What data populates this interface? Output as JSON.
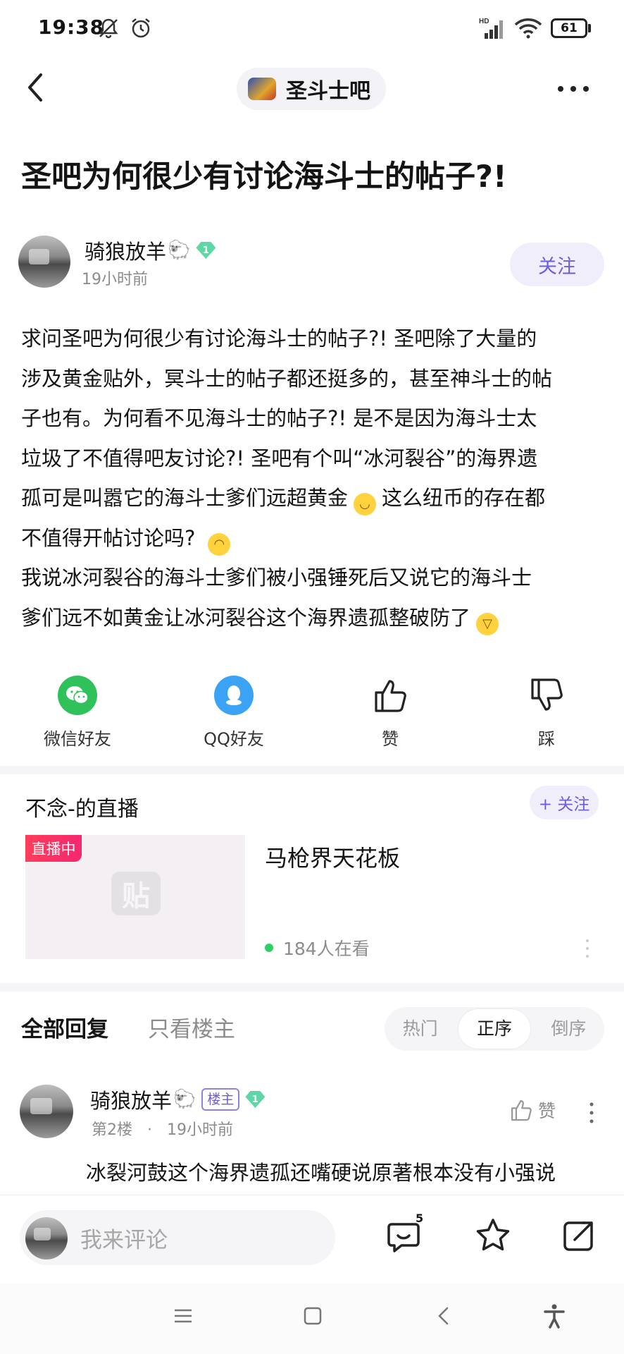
{
  "status_bar": {
    "time": "19:38",
    "battery": "61",
    "icons": [
      "mute-bell-icon",
      "alarm-icon",
      "hd-signal-icon",
      "wifi-icon",
      "battery-icon"
    ]
  },
  "nav": {
    "forum_name": "圣斗士吧"
  },
  "post": {
    "title": "圣吧为何很少有讨论海斗士的帖子?!",
    "author": {
      "name": "骑狼放羊",
      "level": "1",
      "time": "19小时前"
    },
    "follow_label": "关注",
    "body": [
      "求问圣吧为何很少有讨论海斗士的帖子?! 圣吧除了大量的",
      "涉及黄金贴外，冥斗士的帖子都还挺多的，甚至神斗士的帖",
      "子也有。为何看不见海斗士的帖子?! 是不是因为海斗士太",
      "垃圾了不值得吧友讨论?! 圣吧有个叫“冰河裂谷”的海界遗",
      "孤可是叫嚣它的海斗士爹们远超黄金",
      "这么纽币的存在都",
      "不值得开帖讨论吗?",
      "我说冰河裂谷的海斗士爹们被小强锤死后又说它的海斗士",
      "爹们远不如黄金让冰河裂谷这个海界遗孤整破防了"
    ]
  },
  "share": {
    "wechat": "微信好友",
    "qq": "QQ好友",
    "like": "赞",
    "dislike": "踩"
  },
  "live": {
    "title": "不念-的直播",
    "follow_label": "+ 关注",
    "badge": "直播中",
    "placeholder_char": "贴",
    "stream_name": "马枪界天花板",
    "viewers": "184人在看"
  },
  "replies_header": {
    "tab_all": "全部回复",
    "tab_op": "只看楼主",
    "sort_options": [
      "热门",
      "正序",
      "倒序"
    ],
    "active_sort": "正序"
  },
  "reply": {
    "author": "骑狼放羊",
    "op_tag": "楼主",
    "level": "1",
    "floor": "第2楼",
    "separator": "·",
    "time": "19小时前",
    "like_label": "赞",
    "text": "冰裂河鼓这个海界遗孤还嘴硬说原著根本没有小强说"
  },
  "bottom_bar": {
    "comment_placeholder": "我来评论",
    "comment_count": "5"
  },
  "colors": {
    "accent": "#6e5ed8",
    "accent_bg": "#f0eefb",
    "live_red": "#f5276f",
    "wechat_green": "#2fc25b",
    "qq_blue": "#3aa3f5",
    "gem_green": "#5fd6a6"
  }
}
